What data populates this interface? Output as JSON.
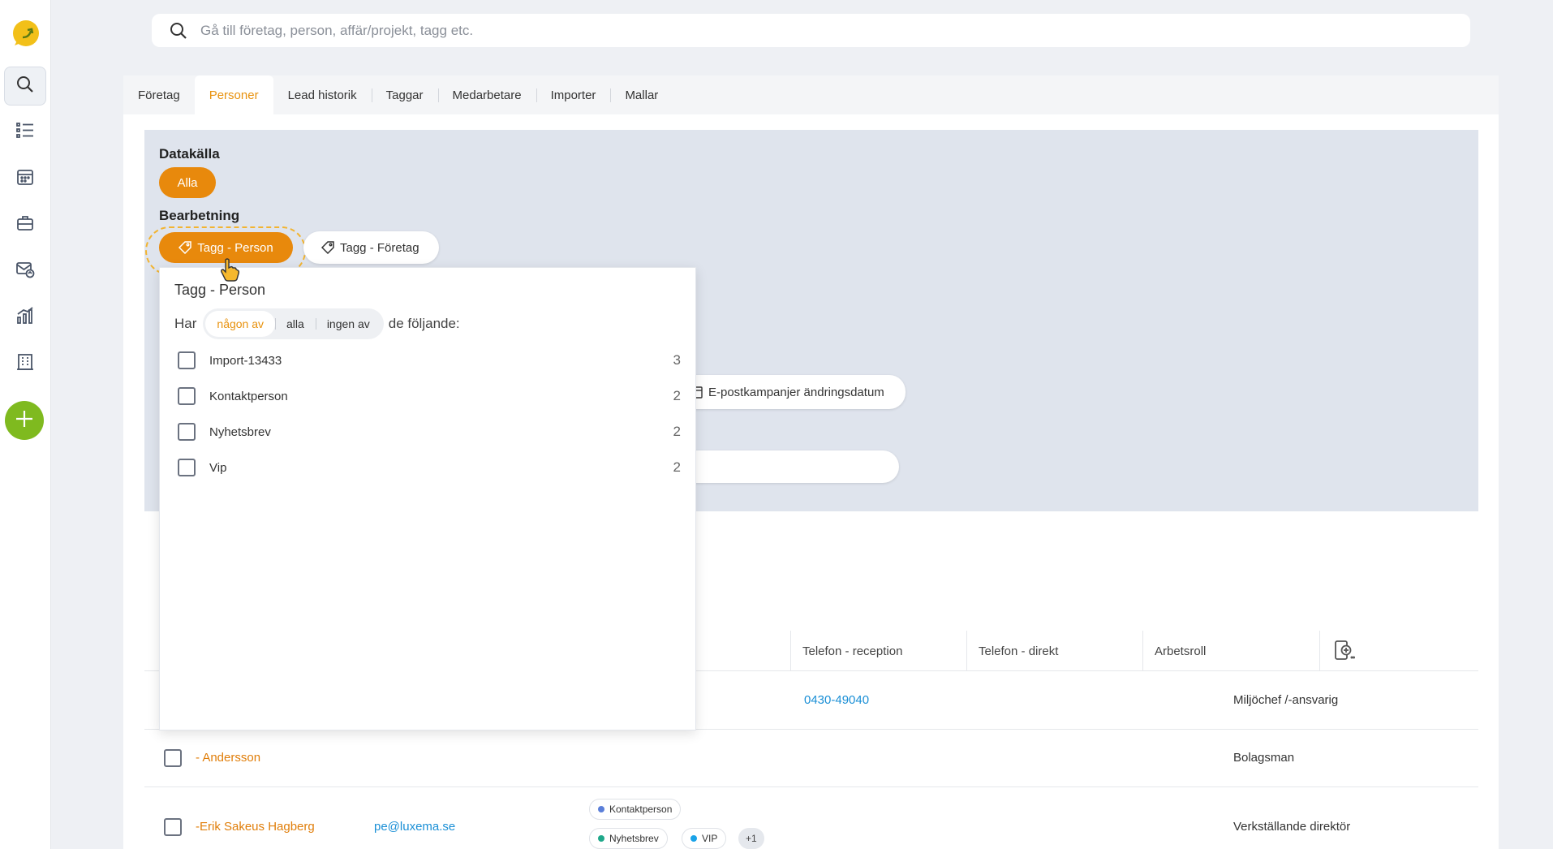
{
  "search": {
    "placeholder": "Gå till företag, person, affär/projekt, tagg etc."
  },
  "sidebar": {
    "items": [
      {
        "name": "search-icon"
      },
      {
        "name": "list-icon"
      },
      {
        "name": "calendar-icon"
      },
      {
        "name": "briefcase-icon"
      },
      {
        "name": "mail-campaign-icon"
      },
      {
        "name": "chart-icon"
      },
      {
        "name": "building-icon"
      }
    ],
    "add_icon": "plus-icon"
  },
  "tabs": [
    "Företag",
    "Personer",
    "Lead historik",
    "Taggar",
    "Medarbetare",
    "Importer",
    "Mallar"
  ],
  "active_tab": "Personer",
  "filters": {
    "datasource_label": "Datakälla",
    "datasource_value": "Alla",
    "processing_label": "Bearbetning",
    "tag_person": "Tagg - Person",
    "tag_company": "Tagg - Företag",
    "campaign_date": "E-postkampanjer ändringsdatum"
  },
  "dropdown": {
    "title": "Tagg - Person",
    "prefix": "Har",
    "modes": [
      "någon av",
      "alla",
      "ingen av"
    ],
    "selected_mode": "någon av",
    "suffix": "de följande:",
    "options": [
      {
        "label": "Import-13433",
        "count": "3"
      },
      {
        "label": "Kontaktperson",
        "count": "2"
      },
      {
        "label": "Nyhetsbrev",
        "count": "2"
      },
      {
        "label": "Vip",
        "count": "2"
      }
    ]
  },
  "table": {
    "columns": [
      "Telefon - reception",
      "Telefon - direkt",
      "Arbetsroll"
    ],
    "rows": [
      {
        "name": "",
        "email": "",
        "phone_reception": "0430-49040",
        "phone_direct": "",
        "role": "Miljöchef /-ansvarig"
      },
      {
        "name": "- Andersson",
        "email": "",
        "phone_reception": "",
        "phone_direct": "",
        "role": "Bolagsman"
      },
      {
        "name": "-Erik Sakeus Hagberg",
        "email": "pe@luxema.se",
        "phone_reception": "",
        "phone_direct": "",
        "role": "Verkställande direktör",
        "tags": [
          "Kontaktperson",
          "Nyhetsbrev",
          "VIP"
        ],
        "more": "+1"
      }
    ]
  },
  "colors": {
    "accent": "#e8890c",
    "link": "#1a8fd6",
    "add_button": "#7fba1f"
  }
}
